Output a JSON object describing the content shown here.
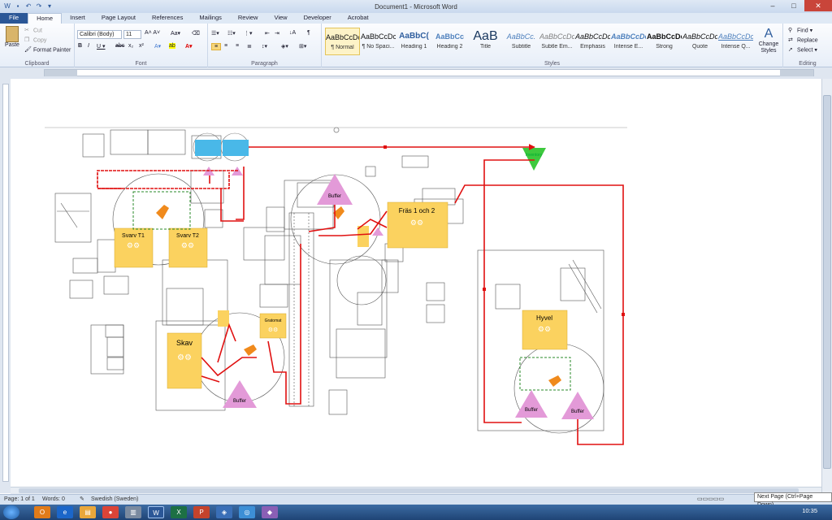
{
  "window": {
    "title": "Document1 - Microsoft Word"
  },
  "tabs": [
    "File",
    "Home",
    "Insert",
    "Page Layout",
    "References",
    "Mailings",
    "Review",
    "View",
    "Developer",
    "Acrobat"
  ],
  "clipboard": {
    "paste": "Paste",
    "cut": "Cut",
    "copy": "Copy",
    "format_painter": "Format Painter",
    "label": "Clipboard"
  },
  "font": {
    "name": "Calibri (Body)",
    "size": "11",
    "label": "Font"
  },
  "paragraph": {
    "label": "Paragraph"
  },
  "styles": {
    "label": "Styles",
    "change_styles": "Change Styles",
    "items": [
      {
        "preview": "AaBbCcDc",
        "name": "¶ Normal"
      },
      {
        "preview": "AaBbCcDc",
        "name": "¶ No Spaci..."
      },
      {
        "preview": "AaBbC(",
        "name": "Heading 1"
      },
      {
        "preview": "AaBbCc",
        "name": "Heading 2"
      },
      {
        "preview": "AaB",
        "name": "Title"
      },
      {
        "preview": "AaBbCc.",
        "name": "Subtitle"
      },
      {
        "preview": "AaBbCcDc",
        "name": "Subtle Em..."
      },
      {
        "preview": "AaBbCcDc",
        "name": "Emphasis"
      },
      {
        "preview": "AaBbCcDc",
        "name": "Intense E..."
      },
      {
        "preview": "AaBbCcDc",
        "name": "Strong"
      },
      {
        "preview": "AaBbCcDc",
        "name": "Quote"
      },
      {
        "preview": "AaBbCcDc",
        "name": "Intense Q..."
      }
    ]
  },
  "editing": {
    "find": "Find",
    "replace": "Replace",
    "select": "Select",
    "label": "Editing"
  },
  "diagram": {
    "inventory": "Inventory",
    "buffer": "Buffer",
    "machines": {
      "svarv_t1": "Svarv T1",
      "svarv_t2": "Svarv T2",
      "fras": "Fräs 1 och 2",
      "skav": "Skav",
      "hyvel": "Hyvel",
      "gratomat": "Gratomat"
    }
  },
  "status": {
    "page": "Page: 1 of 1",
    "words": "Words: 0",
    "language": "Swedish (Sweden)"
  },
  "tooltip": "Next Page (Ctrl+Page Down)",
  "clock": "10:35",
  "colors": {
    "flow": "#e01010",
    "machine": "#fbd25f",
    "buffer": "#e39ad8",
    "inventory": "#3ec93e",
    "fixture": "#49b8e8"
  }
}
